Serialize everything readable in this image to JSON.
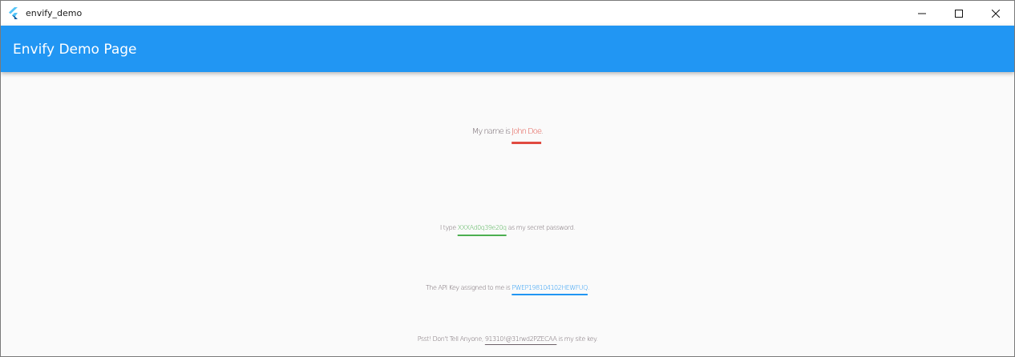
{
  "window": {
    "title": "envify_demo",
    "icon": "flutter-icon",
    "controls": {
      "minimize_icon": "minimize-icon",
      "maximize_icon": "maximize-icon",
      "close_icon": "close-icon"
    }
  },
  "appbar": {
    "title": "Envify Demo Page",
    "color": "#2196f3"
  },
  "lines": [
    {
      "prefix": "My name is ",
      "secret": "John Doe",
      "suffix": ".",
      "secret_color": "#e04a40"
    },
    {
      "prefix": "I type ",
      "secret": "XXXAd0q39e20q",
      "suffix": " as my secret password.",
      "secret_color": "#4caf50"
    },
    {
      "prefix": "The API Key assigned to me is ",
      "secret": "PWEP198104102HEWFUQ",
      "suffix": ".",
      "secret_color": "#2196f3"
    },
    {
      "prefix": "Psst! Don't Tell Anyone, ",
      "secret": "91310!@31rwd2PZECAA",
      "suffix": " is my site key.",
      "secret_color": "#6e6168"
    }
  ],
  "text_color": "#6e6168"
}
